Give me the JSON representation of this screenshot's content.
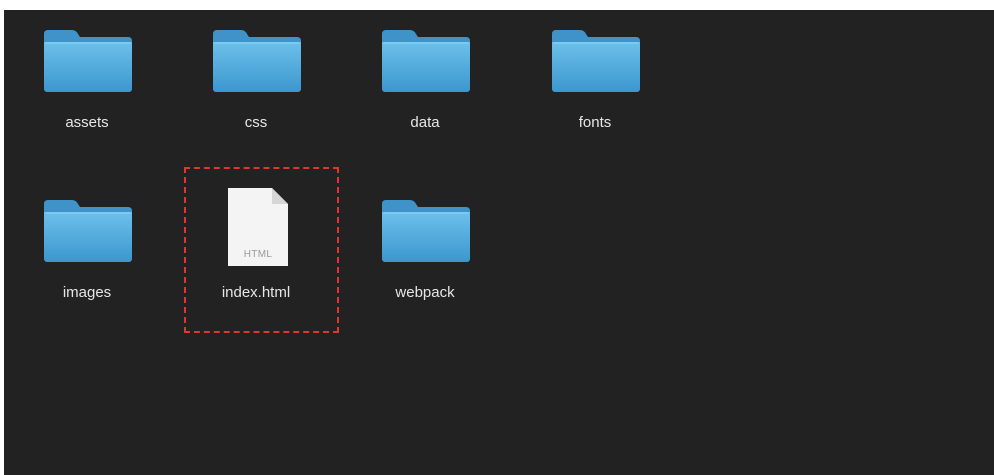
{
  "finder": {
    "items": [
      {
        "label": "assets",
        "type": "folder"
      },
      {
        "label": "css",
        "type": "folder"
      },
      {
        "label": "data",
        "type": "folder"
      },
      {
        "label": "fonts",
        "type": "folder"
      },
      {
        "label": "images",
        "type": "folder"
      },
      {
        "label": "index.html",
        "type": "file",
        "file_type_label": "HTML"
      },
      {
        "label": "webpack",
        "type": "folder"
      }
    ]
  },
  "colors": {
    "background": "#222222",
    "folder_top": "#6cc0ea",
    "folder_bottom": "#3c97cf",
    "highlight_border": "#e0362f",
    "label_text": "#e6e6e6"
  },
  "icons": {
    "folder": "folder-icon",
    "file": "html-file-icon"
  }
}
